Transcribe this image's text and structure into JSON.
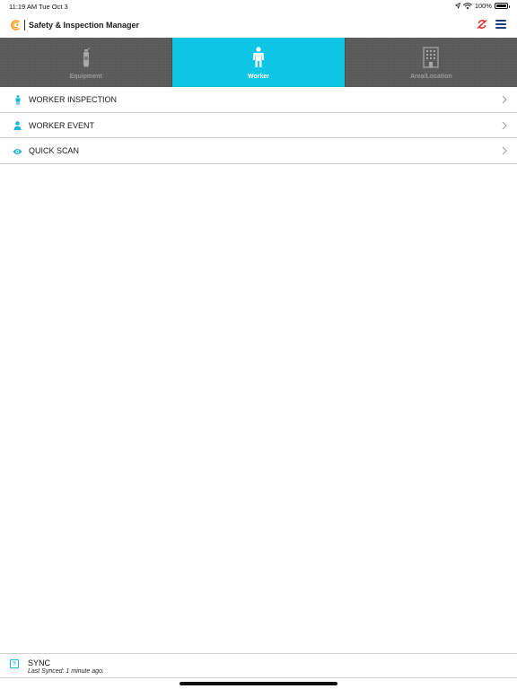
{
  "status_bar": {
    "time": "11:19 AM",
    "date": "Tue Oct 3",
    "battery": "100%"
  },
  "app": {
    "title": "Safety & Inspection Manager",
    "logo_icon": "brand-logo-icon",
    "sync_status_icon": "sync-off-icon",
    "menu_icon": "hamburger-menu-icon",
    "accent_color": "#0fc5e6",
    "logo_color": "#f39a1e",
    "menu_color": "#1d3b7a",
    "alert_color": "#e02020"
  },
  "tabs": [
    {
      "label": "Equipment",
      "icon": "fire-extinguisher-icon",
      "active": false
    },
    {
      "label": "Worker",
      "icon": "person-icon",
      "active": true
    },
    {
      "label": "Area/Location",
      "icon": "building-icon",
      "active": false
    }
  ],
  "menu": [
    {
      "label": "WORKER INSPECTION",
      "icon": "person-icon"
    },
    {
      "label": "WORKER EVENT",
      "icon": "user-icon"
    },
    {
      "label": "QUICK SCAN",
      "icon": "eye-icon"
    }
  ],
  "sync": {
    "title": "SYNC",
    "subtitle": "Last Synced: 1 minute ago.",
    "icon": "sync-help-icon",
    "icon_glyph": "?"
  }
}
